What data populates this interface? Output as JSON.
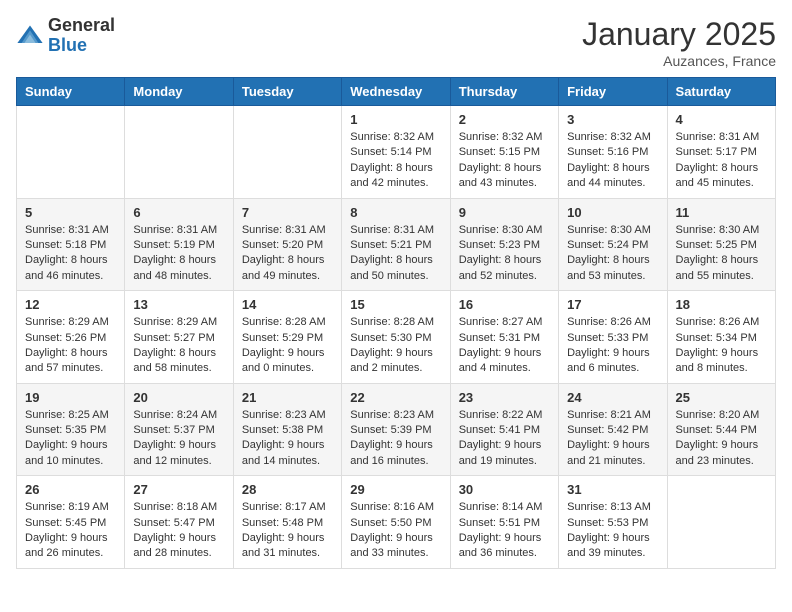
{
  "logo": {
    "general": "General",
    "blue": "Blue"
  },
  "title": "January 2025",
  "location": "Auzances, France",
  "days_of_week": [
    "Sunday",
    "Monday",
    "Tuesday",
    "Wednesday",
    "Thursday",
    "Friday",
    "Saturday"
  ],
  "weeks": [
    [
      {
        "day": "",
        "sunrise": "",
        "sunset": "",
        "daylight": ""
      },
      {
        "day": "",
        "sunrise": "",
        "sunset": "",
        "daylight": ""
      },
      {
        "day": "",
        "sunrise": "",
        "sunset": "",
        "daylight": ""
      },
      {
        "day": "1",
        "sunrise": "Sunrise: 8:32 AM",
        "sunset": "Sunset: 5:14 PM",
        "daylight": "Daylight: 8 hours and 42 minutes."
      },
      {
        "day": "2",
        "sunrise": "Sunrise: 8:32 AM",
        "sunset": "Sunset: 5:15 PM",
        "daylight": "Daylight: 8 hours and 43 minutes."
      },
      {
        "day": "3",
        "sunrise": "Sunrise: 8:32 AM",
        "sunset": "Sunset: 5:16 PM",
        "daylight": "Daylight: 8 hours and 44 minutes."
      },
      {
        "day": "4",
        "sunrise": "Sunrise: 8:31 AM",
        "sunset": "Sunset: 5:17 PM",
        "daylight": "Daylight: 8 hours and 45 minutes."
      }
    ],
    [
      {
        "day": "5",
        "sunrise": "Sunrise: 8:31 AM",
        "sunset": "Sunset: 5:18 PM",
        "daylight": "Daylight: 8 hours and 46 minutes."
      },
      {
        "day": "6",
        "sunrise": "Sunrise: 8:31 AM",
        "sunset": "Sunset: 5:19 PM",
        "daylight": "Daylight: 8 hours and 48 minutes."
      },
      {
        "day": "7",
        "sunrise": "Sunrise: 8:31 AM",
        "sunset": "Sunset: 5:20 PM",
        "daylight": "Daylight: 8 hours and 49 minutes."
      },
      {
        "day": "8",
        "sunrise": "Sunrise: 8:31 AM",
        "sunset": "Sunset: 5:21 PM",
        "daylight": "Daylight: 8 hours and 50 minutes."
      },
      {
        "day": "9",
        "sunrise": "Sunrise: 8:30 AM",
        "sunset": "Sunset: 5:23 PM",
        "daylight": "Daylight: 8 hours and 52 minutes."
      },
      {
        "day": "10",
        "sunrise": "Sunrise: 8:30 AM",
        "sunset": "Sunset: 5:24 PM",
        "daylight": "Daylight: 8 hours and 53 minutes."
      },
      {
        "day": "11",
        "sunrise": "Sunrise: 8:30 AM",
        "sunset": "Sunset: 5:25 PM",
        "daylight": "Daylight: 8 hours and 55 minutes."
      }
    ],
    [
      {
        "day": "12",
        "sunrise": "Sunrise: 8:29 AM",
        "sunset": "Sunset: 5:26 PM",
        "daylight": "Daylight: 8 hours and 57 minutes."
      },
      {
        "day": "13",
        "sunrise": "Sunrise: 8:29 AM",
        "sunset": "Sunset: 5:27 PM",
        "daylight": "Daylight: 8 hours and 58 minutes."
      },
      {
        "day": "14",
        "sunrise": "Sunrise: 8:28 AM",
        "sunset": "Sunset: 5:29 PM",
        "daylight": "Daylight: 9 hours and 0 minutes."
      },
      {
        "day": "15",
        "sunrise": "Sunrise: 8:28 AM",
        "sunset": "Sunset: 5:30 PM",
        "daylight": "Daylight: 9 hours and 2 minutes."
      },
      {
        "day": "16",
        "sunrise": "Sunrise: 8:27 AM",
        "sunset": "Sunset: 5:31 PM",
        "daylight": "Daylight: 9 hours and 4 minutes."
      },
      {
        "day": "17",
        "sunrise": "Sunrise: 8:26 AM",
        "sunset": "Sunset: 5:33 PM",
        "daylight": "Daylight: 9 hours and 6 minutes."
      },
      {
        "day": "18",
        "sunrise": "Sunrise: 8:26 AM",
        "sunset": "Sunset: 5:34 PM",
        "daylight": "Daylight: 9 hours and 8 minutes."
      }
    ],
    [
      {
        "day": "19",
        "sunrise": "Sunrise: 8:25 AM",
        "sunset": "Sunset: 5:35 PM",
        "daylight": "Daylight: 9 hours and 10 minutes."
      },
      {
        "day": "20",
        "sunrise": "Sunrise: 8:24 AM",
        "sunset": "Sunset: 5:37 PM",
        "daylight": "Daylight: 9 hours and 12 minutes."
      },
      {
        "day": "21",
        "sunrise": "Sunrise: 8:23 AM",
        "sunset": "Sunset: 5:38 PM",
        "daylight": "Daylight: 9 hours and 14 minutes."
      },
      {
        "day": "22",
        "sunrise": "Sunrise: 8:23 AM",
        "sunset": "Sunset: 5:39 PM",
        "daylight": "Daylight: 9 hours and 16 minutes."
      },
      {
        "day": "23",
        "sunrise": "Sunrise: 8:22 AM",
        "sunset": "Sunset: 5:41 PM",
        "daylight": "Daylight: 9 hours and 19 minutes."
      },
      {
        "day": "24",
        "sunrise": "Sunrise: 8:21 AM",
        "sunset": "Sunset: 5:42 PM",
        "daylight": "Daylight: 9 hours and 21 minutes."
      },
      {
        "day": "25",
        "sunrise": "Sunrise: 8:20 AM",
        "sunset": "Sunset: 5:44 PM",
        "daylight": "Daylight: 9 hours and 23 minutes."
      }
    ],
    [
      {
        "day": "26",
        "sunrise": "Sunrise: 8:19 AM",
        "sunset": "Sunset: 5:45 PM",
        "daylight": "Daylight: 9 hours and 26 minutes."
      },
      {
        "day": "27",
        "sunrise": "Sunrise: 8:18 AM",
        "sunset": "Sunset: 5:47 PM",
        "daylight": "Daylight: 9 hours and 28 minutes."
      },
      {
        "day": "28",
        "sunrise": "Sunrise: 8:17 AM",
        "sunset": "Sunset: 5:48 PM",
        "daylight": "Daylight: 9 hours and 31 minutes."
      },
      {
        "day": "29",
        "sunrise": "Sunrise: 8:16 AM",
        "sunset": "Sunset: 5:50 PM",
        "daylight": "Daylight: 9 hours and 33 minutes."
      },
      {
        "day": "30",
        "sunrise": "Sunrise: 8:14 AM",
        "sunset": "Sunset: 5:51 PM",
        "daylight": "Daylight: 9 hours and 36 minutes."
      },
      {
        "day": "31",
        "sunrise": "Sunrise: 8:13 AM",
        "sunset": "Sunset: 5:53 PM",
        "daylight": "Daylight: 9 hours and 39 minutes."
      },
      {
        "day": "",
        "sunrise": "",
        "sunset": "",
        "daylight": ""
      }
    ]
  ]
}
